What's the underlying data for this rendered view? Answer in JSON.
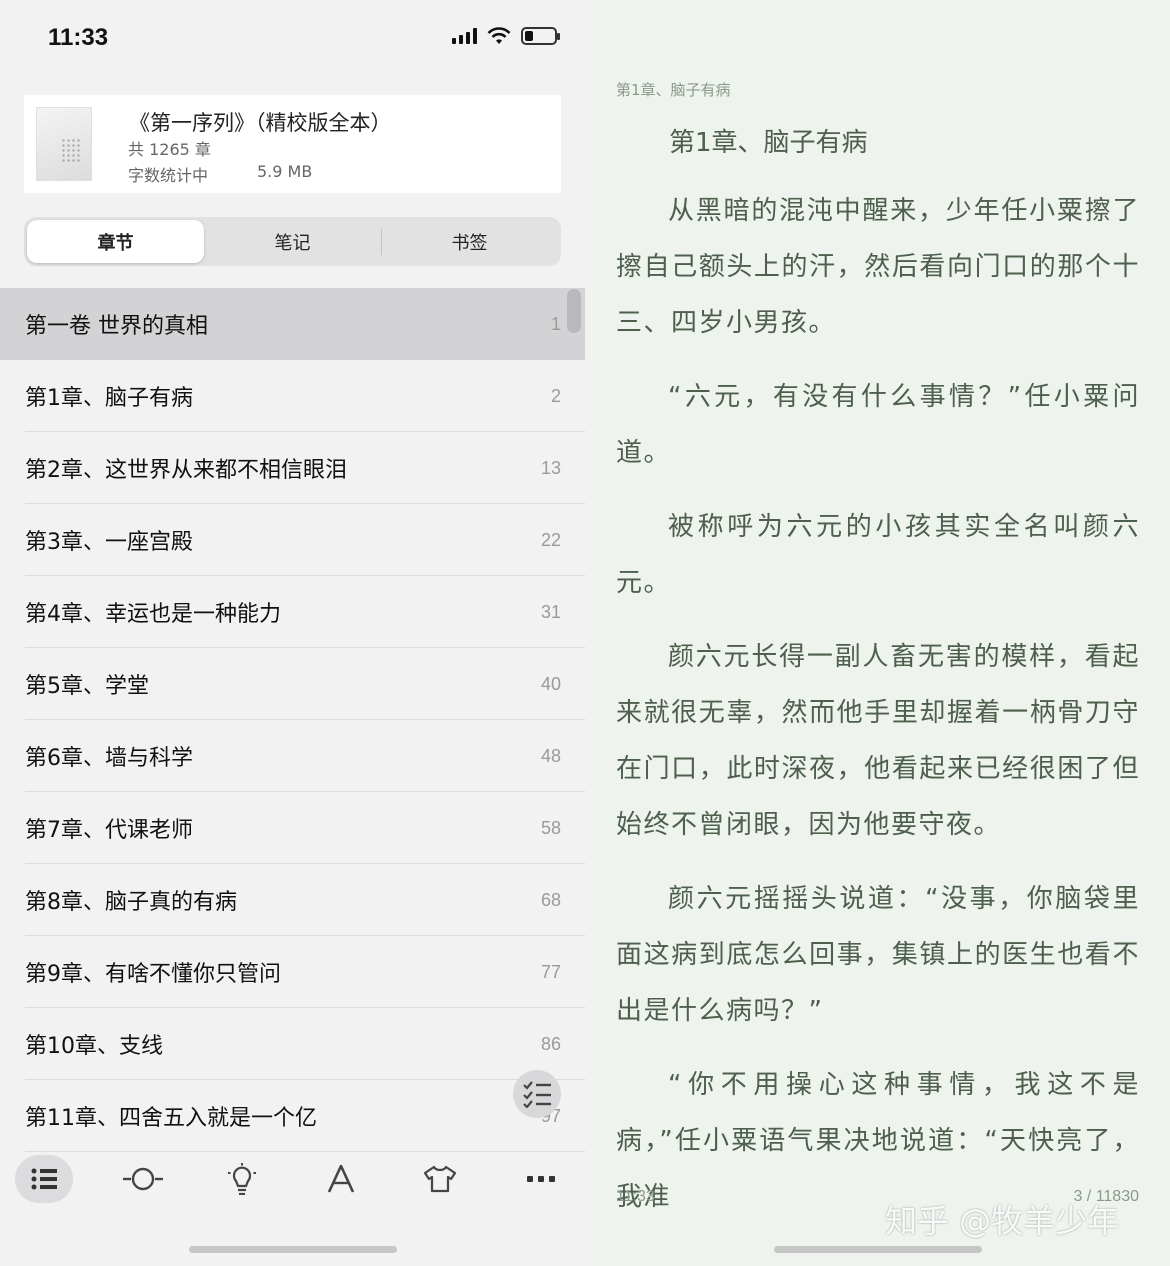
{
  "status_bar": {
    "time": "11:33"
  },
  "book": {
    "title": "《第一序列》（精校版全本）",
    "chapters": "共 1265 章",
    "word_count": "字数统计中",
    "size": "5.9 MB"
  },
  "tabs": [
    "章节",
    "笔记",
    "书签"
  ],
  "toc": [
    {
      "title": "第一卷 世界的真相",
      "page": "1"
    },
    {
      "title": "第1章、脑子有病",
      "page": "2"
    },
    {
      "title": "第2章、这世界从来都不相信眼泪",
      "page": "13"
    },
    {
      "title": "第3章、一座宫殿",
      "page": "22"
    },
    {
      "title": "第4章、幸运也是一种能力",
      "page": "31"
    },
    {
      "title": "第5章、学堂",
      "page": "40"
    },
    {
      "title": "第6章、墙与科学",
      "page": "48"
    },
    {
      "title": "第7章、代课老师",
      "page": "58"
    },
    {
      "title": "第8章、脑子真的有病",
      "page": "68"
    },
    {
      "title": "第9章、有啥不懂你只管问",
      "page": "77"
    },
    {
      "title": "第10章、支线",
      "page": "86"
    },
    {
      "title": "第11章、四舍五入就是一个亿",
      "page": "97"
    }
  ],
  "toolbar": {
    "icons": [
      "list-icon",
      "progress-slider-icon",
      "brightness-icon",
      "font-icon",
      "theme-shirt-icon",
      "more-icon"
    ]
  },
  "reader": {
    "header": "第1章、脑子有病",
    "chapter_title": "第1章、脑子有病",
    "paragraphs": [
      "从黑暗的混沌中醒来，少年任小粟擦了擦自己额头上的汗，然后看向门口的那个十三、四岁小男孩。",
      "“六元，有没有什么事情？”任小粟问道。",
      "被称呼为六元的小孩其实全名叫颜六元。",
      "颜六元长得一副人畜无害的模样，看起来就很无辜，然而他手里却握着一柄骨刀守在门口，此时深夜，他看起来已经很困了但始终不曾闭眼，因为他要守夜。",
      "颜六元摇摇头说道：“没事，你脑袋里面这病到底怎么回事，集镇上的医生也看不出是什么病吗？”",
      "“你不用操心这种事情，我这不是病，”任小粟语气果决地说道：“天快亮了，我准"
    ],
    "time": "11:33",
    "progress": "3 / 11830"
  },
  "watermark": "知乎 @牧羊少年",
  "colors": {
    "reader_bg": "#eef3ee",
    "reader_text": "#4e5f4e",
    "toc_highlight": "#d3d3d6"
  }
}
